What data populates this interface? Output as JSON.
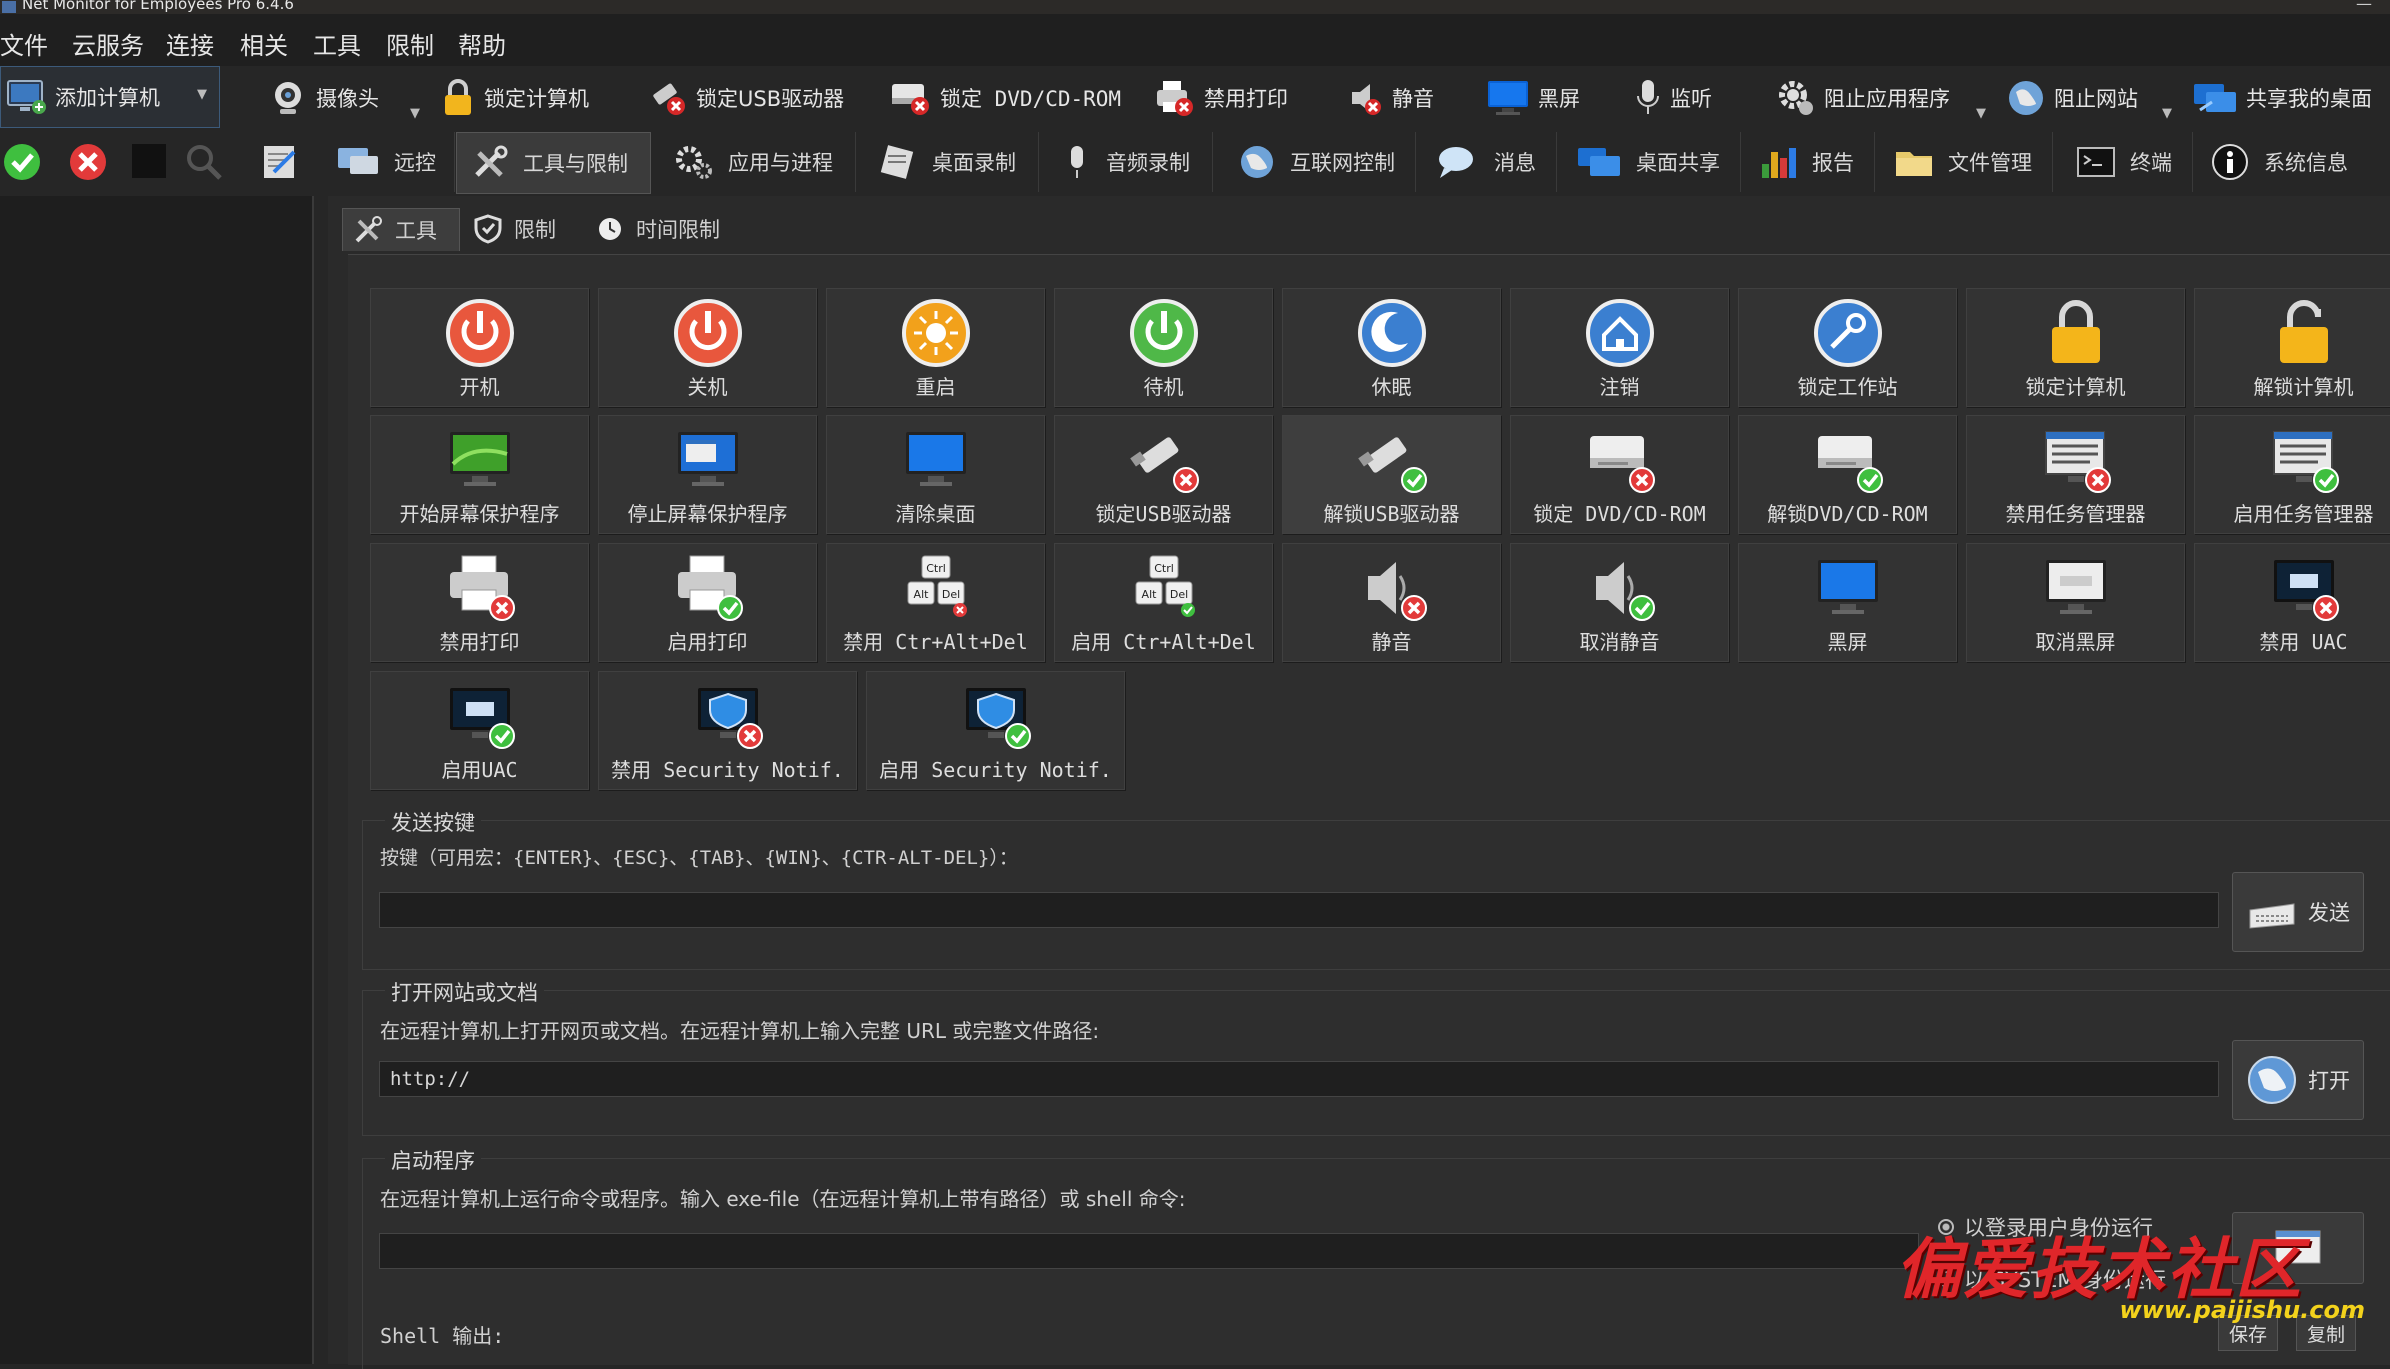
{
  "window": {
    "title": "Net Monitor for Employees Pro 6.4.6",
    "minimize_glyph": "—"
  },
  "menu": [
    "文件",
    "云服务",
    "连接",
    "相关",
    "工具",
    "限制",
    "帮助"
  ],
  "toolbar1": {
    "add_computer": "添加计算机",
    "items": [
      "摄像头",
      "锁定计算机",
      "锁定USB驱动器",
      "锁定 DVD/CD-ROM",
      "禁用打印",
      "静音",
      "黑屏",
      "监听",
      "阻止应用程序",
      "阻止网站",
      "共享我的桌面"
    ]
  },
  "toolbar2": {
    "tabs": [
      "远控",
      "工具与限制",
      "应用与进程",
      "桌面录制",
      "音频录制",
      "互联网控制",
      "消息",
      "桌面共享",
      "报告",
      "文件管理",
      "终端",
      "系统信息"
    ],
    "active_tab": "工具与限制"
  },
  "subtabs": [
    "工具",
    "限制",
    "时间限制"
  ],
  "tools": [
    {
      "label": "开机",
      "icon": "power-on-icon"
    },
    {
      "label": "关机",
      "icon": "shutdown-icon"
    },
    {
      "label": "重启",
      "icon": "restart-icon"
    },
    {
      "label": "待机",
      "icon": "standby-icon"
    },
    {
      "label": "休眠",
      "icon": "hibernate-icon"
    },
    {
      "label": "注销",
      "icon": "logoff-icon"
    },
    {
      "label": "锁定工作站",
      "icon": "lock-workstation-icon"
    },
    {
      "label": "锁定计算机",
      "icon": "lock-computer-icon"
    },
    {
      "label": "解锁计算机",
      "icon": "unlock-computer-icon"
    },
    {
      "label": "开始屏幕保护程序",
      "icon": "start-screensaver-icon"
    },
    {
      "label": "停止屏幕保护程序",
      "icon": "stop-screensaver-icon"
    },
    {
      "label": "清除桌面",
      "icon": "clear-desktop-icon"
    },
    {
      "label": "锁定USB驱动器",
      "icon": "lock-usb-icon"
    },
    {
      "label": "解锁USB驱动器",
      "icon": "unlock-usb-icon"
    },
    {
      "label": "锁定 DVD/CD-ROM",
      "icon": "lock-dvd-icon"
    },
    {
      "label": "解锁DVD/CD-ROM",
      "icon": "unlock-dvd-icon"
    },
    {
      "label": "禁用任务管理器",
      "icon": "disable-task-manager-icon"
    },
    {
      "label": "启用任务管理器",
      "icon": "enable-task-manager-icon"
    },
    {
      "label": "禁用打印",
      "icon": "disable-print-icon"
    },
    {
      "label": "启用打印",
      "icon": "enable-print-icon"
    },
    {
      "label": "禁用 Ctr+Alt+Del",
      "icon": "disable-ctrl-alt-del-icon"
    },
    {
      "label": "启用 Ctr+Alt+Del",
      "icon": "enable-ctrl-alt-del-icon"
    },
    {
      "label": "静音",
      "icon": "mute-icon"
    },
    {
      "label": "取消静音",
      "icon": "unmute-icon"
    },
    {
      "label": "黑屏",
      "icon": "black-screen-icon"
    },
    {
      "label": "取消黑屏",
      "icon": "cancel-black-screen-icon"
    },
    {
      "label": "禁用 UAC",
      "icon": "disable-uac-icon"
    },
    {
      "label": "启用UAC",
      "icon": "enable-uac-icon"
    },
    {
      "label": "禁用 Security Notif.",
      "icon": "disable-security-notif-icon"
    },
    {
      "label": "启用 Security Notif.",
      "icon": "enable-security-notif-icon"
    }
  ],
  "ctrl_key_labels": {
    "ctrl": "Ctrl",
    "alt": "Alt",
    "del": "Del"
  },
  "send_keys": {
    "title": "发送按键",
    "desc": "按键（可用宏：{ENTER}、{ESC}、{TAB}、{WIN}、{CTR-ALT-DEL}）：",
    "value": "",
    "button": "发送"
  },
  "open_site": {
    "title": "打开网站或文档",
    "desc": "在远程计算机上打开网页或文档。在远程计算机上输入完整 URL 或完整文件路径:",
    "value": "http://",
    "button": "打开"
  },
  "run_program": {
    "title": "启动程序",
    "desc": "在远程计算机上运行命令或程序。输入 exe-file（在远程计算机上带有路径）或 shell 命令:",
    "value": "",
    "radio1": "以登录用户身份运行",
    "radio2": "以 SYSTEM 身份运行",
    "shell_label": "Shell 输出:",
    "save": "保存",
    "copy": "复制"
  },
  "watermark": {
    "text": "偏爱技术社区",
    "url": "www.paijishu.com"
  }
}
